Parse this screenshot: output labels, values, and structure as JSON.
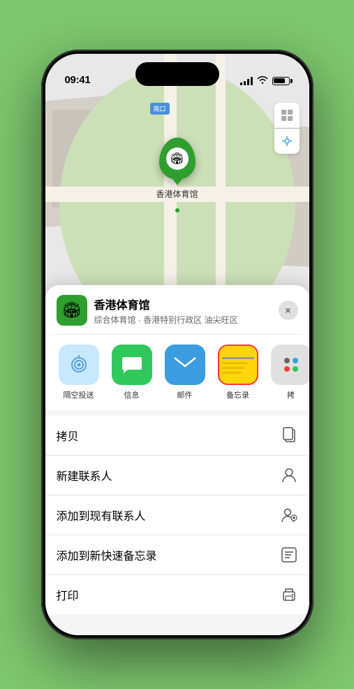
{
  "phone": {
    "status_bar": {
      "time": "09:41",
      "signal_label": "signal",
      "wifi_label": "wifi",
      "battery_label": "battery"
    },
    "map": {
      "label_text": "南口",
      "pin_label": "香港体育馆",
      "pin_emoji": "🏟"
    },
    "place_sheet": {
      "icon_emoji": "🏟",
      "place_name": "香港体育馆",
      "place_sub": "综合体育馆 · 香港特别行政区 油尖旺区",
      "close_label": "×",
      "share_items": [
        {
          "id": "airdrop",
          "label": "隔空投送",
          "icon_type": "airdrop"
        },
        {
          "id": "messages",
          "label": "信息",
          "icon_type": "messages"
        },
        {
          "id": "mail",
          "label": "邮件",
          "icon_type": "mail"
        },
        {
          "id": "notes",
          "label": "备忘录",
          "icon_type": "notes"
        },
        {
          "id": "more",
          "label": "拷",
          "icon_type": "more"
        }
      ],
      "actions": [
        {
          "id": "copy",
          "label": "拷贝",
          "icon": "📋"
        },
        {
          "id": "new-contact",
          "label": "新建联系人",
          "icon": "👤"
        },
        {
          "id": "add-existing",
          "label": "添加到现有联系人",
          "icon": "👤"
        },
        {
          "id": "quick-note",
          "label": "添加到新快速备忘录",
          "icon": "📝"
        },
        {
          "id": "print",
          "label": "打印",
          "icon": "🖨"
        }
      ]
    }
  }
}
